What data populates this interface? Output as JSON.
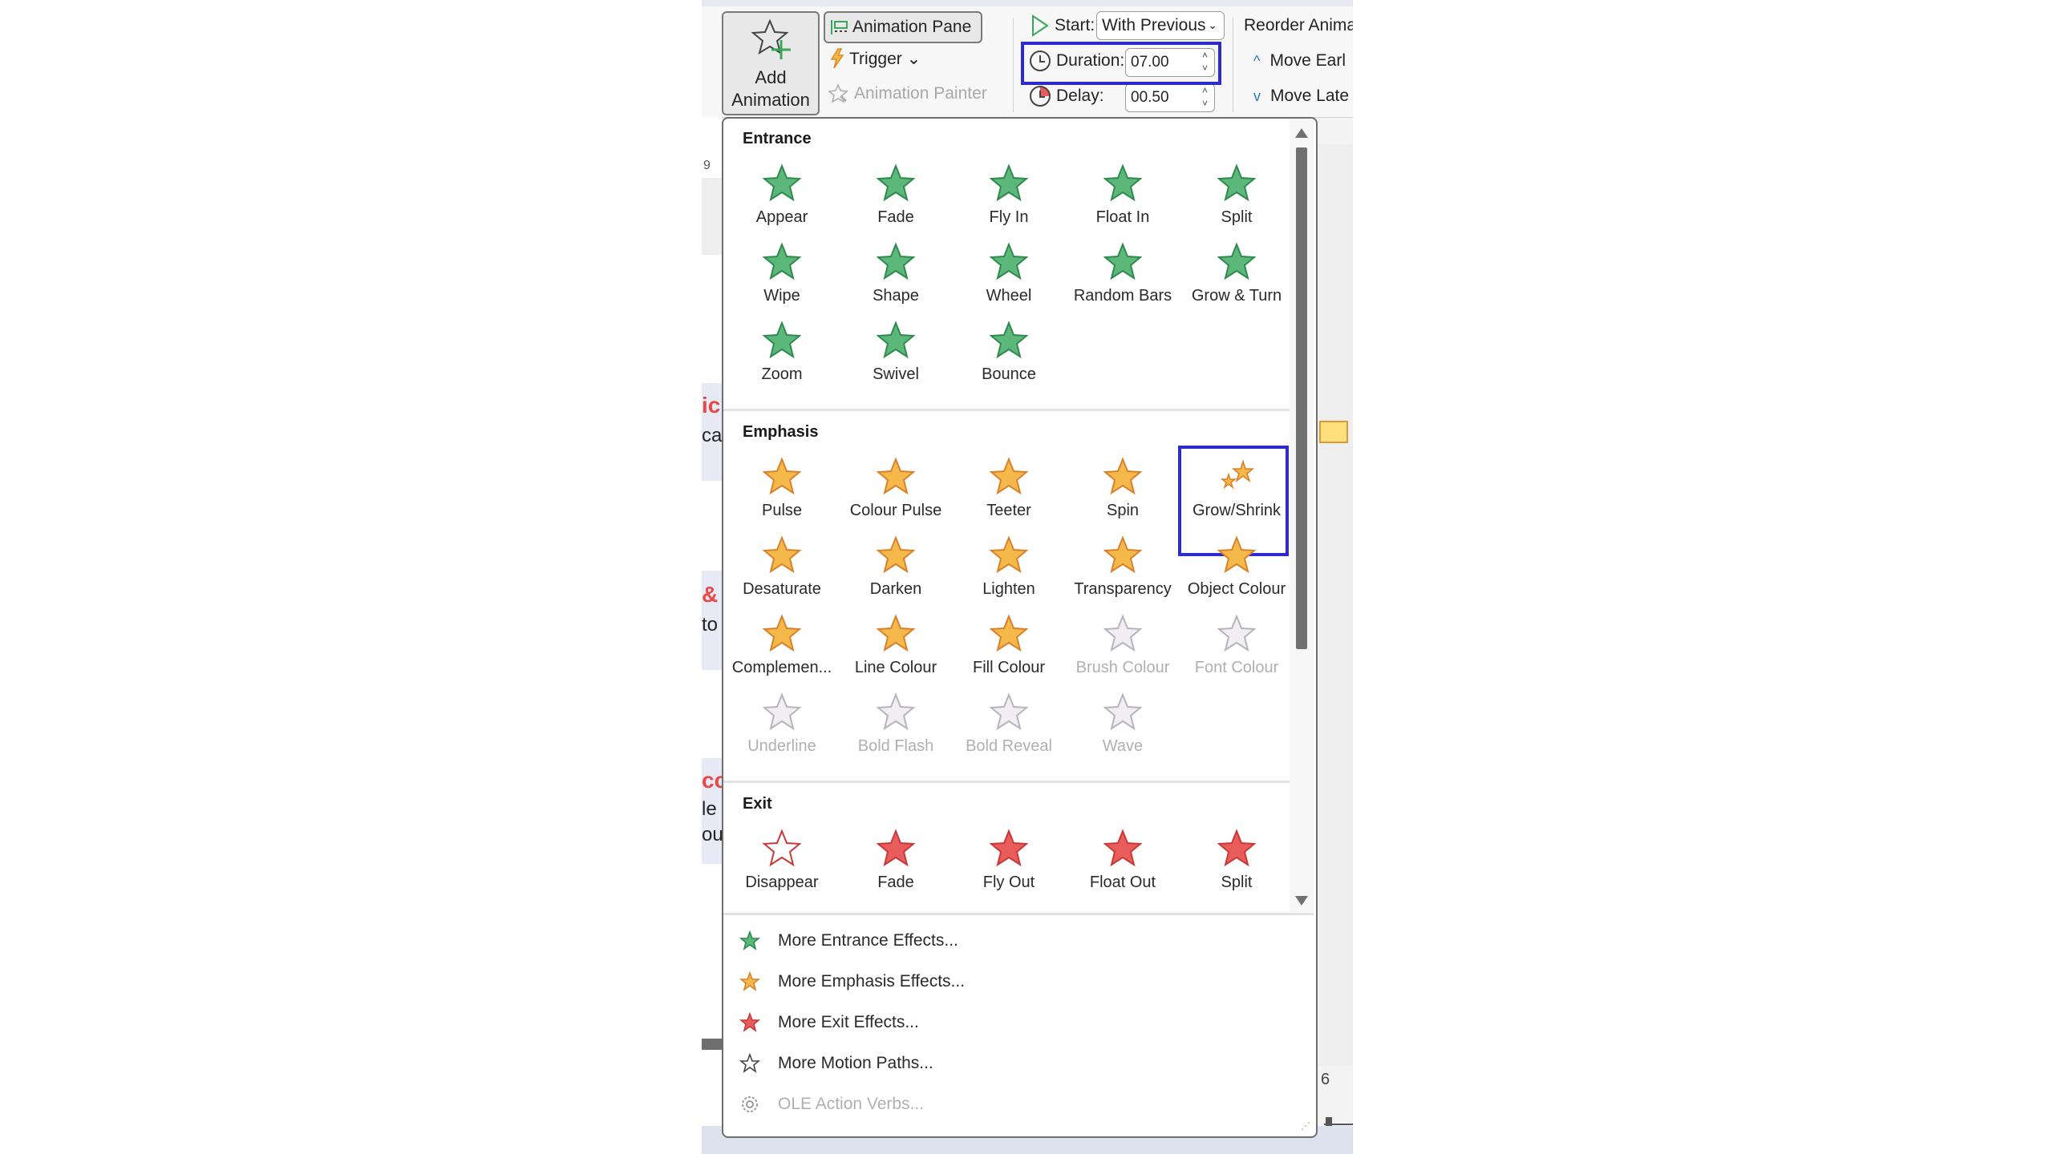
{
  "ribbon": {
    "add_animation": {
      "line1": "Add",
      "line2": "Animation ⌄"
    },
    "animation_pane": "Animation Pane",
    "trigger": "Trigger ⌄",
    "animation_painter": "Animation Painter",
    "start_label": "Start:",
    "start_value": "With Previous",
    "duration_label": "Duration:",
    "duration_value": "07.00",
    "delay_label": "Delay:",
    "delay_value": "00.50",
    "reorder_title": "Reorder Anima",
    "move_earlier": "Move Earl",
    "move_later": "Move Late"
  },
  "slide_fragments": [
    {
      "accent": "ic",
      "text": "ca"
    },
    {
      "accent": "&",
      "text": "to"
    },
    {
      "accent": "cc",
      "text": "le",
      "text2": "ou"
    }
  ],
  "slide_numbers": {
    "top": "9",
    "bottom": "6"
  },
  "gallery": {
    "sections": [
      {
        "title": "Entrance",
        "color": "#5cb87a",
        "items": [
          {
            "label": "Appear",
            "enabled": true
          },
          {
            "label": "Fade",
            "enabled": true
          },
          {
            "label": "Fly In",
            "enabled": true
          },
          {
            "label": "Float In",
            "enabled": true
          },
          {
            "label": "Split",
            "enabled": true
          },
          {
            "label": "Wipe",
            "enabled": true
          },
          {
            "label": "Shape",
            "enabled": true
          },
          {
            "label": "Wheel",
            "enabled": true
          },
          {
            "label": "Random Bars",
            "enabled": true
          },
          {
            "label": "Grow & Turn",
            "enabled": true
          },
          {
            "label": "Zoom",
            "enabled": true
          },
          {
            "label": "Swivel",
            "enabled": true
          },
          {
            "label": "Bounce",
            "enabled": true
          }
        ]
      },
      {
        "title": "Emphasis",
        "color": "#f5b84a",
        "items": [
          {
            "label": "Pulse",
            "enabled": true
          },
          {
            "label": "Colour Pulse",
            "enabled": true
          },
          {
            "label": "Teeter",
            "enabled": true
          },
          {
            "label": "Spin",
            "enabled": true
          },
          {
            "label": "Grow/Shrink",
            "enabled": true,
            "highlighted": true
          },
          {
            "label": "Desaturate",
            "enabled": true
          },
          {
            "label": "Darken",
            "enabled": true
          },
          {
            "label": "Lighten",
            "enabled": true
          },
          {
            "label": "Transparency",
            "enabled": true
          },
          {
            "label": "Object Colour",
            "enabled": true
          },
          {
            "label": "Complemen...",
            "enabled": true
          },
          {
            "label": "Line Colour",
            "enabled": true
          },
          {
            "label": "Fill Colour",
            "enabled": true
          },
          {
            "label": "Brush Colour",
            "enabled": false
          },
          {
            "label": "Font Colour",
            "enabled": false
          },
          {
            "label": "Underline",
            "enabled": false
          },
          {
            "label": "Bold Flash",
            "enabled": false
          },
          {
            "label": "Bold Reveal",
            "enabled": false
          },
          {
            "label": "Wave",
            "enabled": false
          }
        ]
      },
      {
        "title": "Exit",
        "color": "#e85c5c",
        "items": [
          {
            "label": "Disappear",
            "enabled": true
          },
          {
            "label": "Fade",
            "enabled": true
          },
          {
            "label": "Fly Out",
            "enabled": true
          },
          {
            "label": "Float Out",
            "enabled": true
          },
          {
            "label": "Split",
            "enabled": true
          }
        ]
      }
    ]
  },
  "menu": [
    {
      "label": "More Entrance Effects...",
      "icon": "entrance-star-icon",
      "enabled": true
    },
    {
      "label": "More Emphasis Effects...",
      "icon": "emphasis-star-icon",
      "enabled": true
    },
    {
      "label": "More Exit Effects...",
      "icon": "exit-star-icon",
      "enabled": true
    },
    {
      "label": "More Motion Paths...",
      "icon": "motion-path-star-icon",
      "enabled": true
    },
    {
      "label": "OLE Action Verbs...",
      "icon": "gear-icon",
      "enabled": false
    }
  ],
  "colors": {
    "highlight": "#2b2bd0",
    "entrance": "#5cb87a",
    "emphasis": "#f5b84a",
    "exit": "#e85c5c",
    "disabled": "#c8c4cc"
  }
}
